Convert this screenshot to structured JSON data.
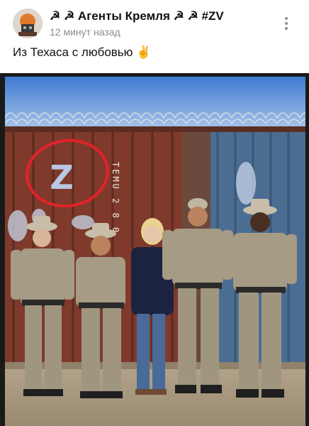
{
  "post": {
    "channel_name": "☭ ☭ Агенты Кремля ☭ ☭ #ZV",
    "timestamp": "12 минут назад",
    "text": "Из Техаса с любовью ✌️",
    "menu_icon": "more-vertical-icon"
  },
  "photo": {
    "container_text": "TEMU 2 8 0",
    "graffiti": "Z"
  },
  "colors": {
    "sky": "#5b8fd4",
    "container_rust": "#8a3a2e",
    "container_blue": "#4e6f96",
    "uniform": "#a89d86",
    "circle": "#e0242b",
    "timestamp": "#8c8c8c"
  }
}
